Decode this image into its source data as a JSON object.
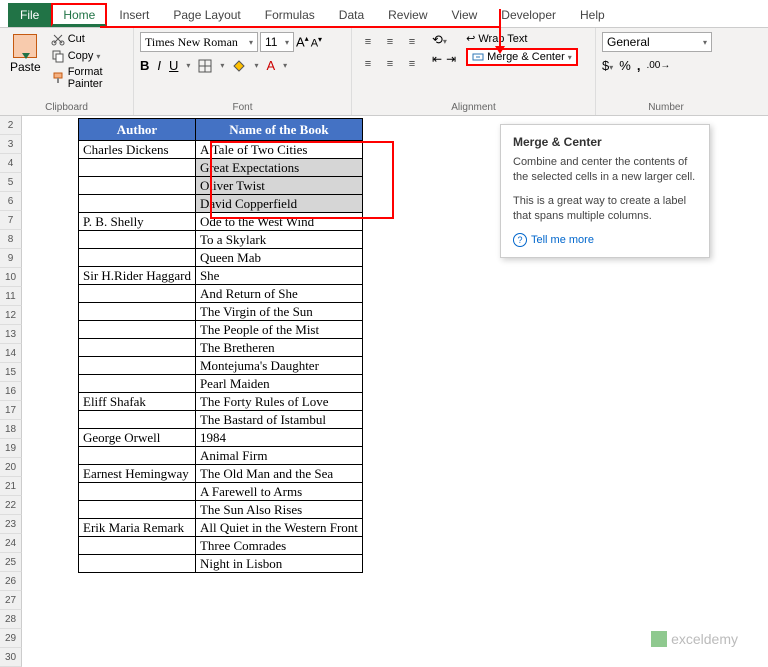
{
  "tabs": [
    "File",
    "Home",
    "Insert",
    "Page Layout",
    "Formulas",
    "Data",
    "Review",
    "View",
    "Developer",
    "Help"
  ],
  "clipboard": {
    "paste": "Paste",
    "cut": "Cut",
    "copy": "Copy",
    "fmt": "Format Painter",
    "label": "Clipboard"
  },
  "font": {
    "name": "Times New Roman",
    "size": "11",
    "label": "Font"
  },
  "align": {
    "wrap": "Wrap Text",
    "merge": "Merge & Center",
    "label": "Alignment"
  },
  "number": {
    "format": "General",
    "label": "Number"
  },
  "tooltip": {
    "title": "Merge & Center",
    "p1": "Combine and center the contents of the selected cells in a new larger cell.",
    "p2": "This is a great way to create a label that spans multiple columns.",
    "more": "Tell me more"
  },
  "headers": {
    "a": "Author",
    "b": "Name of the Book"
  },
  "rows": [
    {
      "a": "Charles Dickens",
      "b": "A Tale of Two Cities"
    },
    {
      "a": "",
      "b": "Great Expectations"
    },
    {
      "a": "",
      "b": "Oliver Twist"
    },
    {
      "a": "",
      "b": "David Copperfield"
    },
    {
      "a": "P. B. Shelly",
      "b": "Ode to the West Wind"
    },
    {
      "a": "",
      "b": "To a Skylark"
    },
    {
      "a": "",
      "b": "Queen Mab"
    },
    {
      "a": "Sir H.Rider Haggard",
      "b": "She"
    },
    {
      "a": "",
      "b": "And Return of She"
    },
    {
      "a": "",
      "b": "The Virgin of the Sun"
    },
    {
      "a": "",
      "b": "The People of the Mist"
    },
    {
      "a": "",
      "b": "The Bretheren"
    },
    {
      "a": "",
      "b": "Montejuma's Daughter"
    },
    {
      "a": "",
      "b": "Pearl Maiden"
    },
    {
      "a": "Eliff Shafak",
      "b": "The Forty Rules of Love"
    },
    {
      "a": "",
      "b": "The Bastard of Istambul"
    },
    {
      "a": "George Orwell",
      "b": "1984"
    },
    {
      "a": "",
      "b": "Animal Firm"
    },
    {
      "a": "Earnest Hemingway",
      "b": "The Old Man and the Sea"
    },
    {
      "a": "",
      "b": "A Farewell to Arms"
    },
    {
      "a": "",
      "b": "The Sun Also Rises"
    },
    {
      "a": "Erik Maria Remark",
      "b": "All Quiet in the Western Front"
    },
    {
      "a": "",
      "b": "Three Comrades"
    },
    {
      "a": "",
      "b": "Night in Lisbon"
    }
  ],
  "rownums": [
    2,
    3,
    4,
    5,
    6,
    7,
    8,
    9,
    10,
    11,
    12,
    13,
    14,
    15,
    16,
    17,
    18,
    19,
    20,
    21,
    22,
    23,
    24,
    25,
    26,
    27,
    28,
    29,
    30
  ],
  "watermark": "exceldemy"
}
